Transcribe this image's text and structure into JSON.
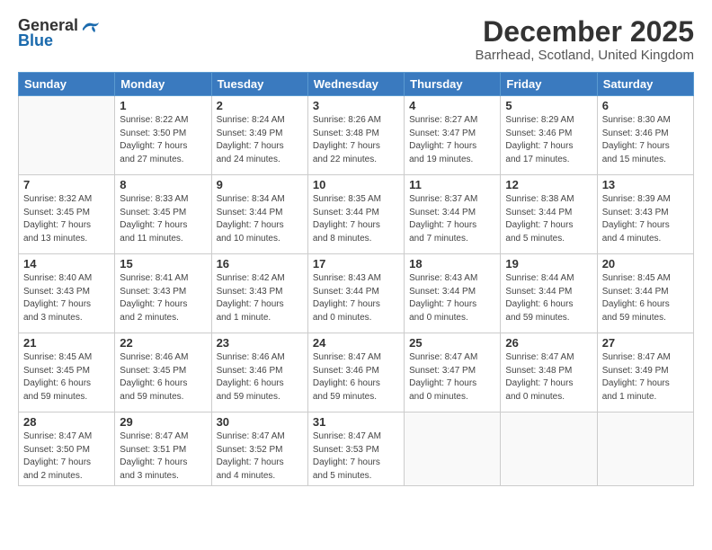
{
  "logo": {
    "general": "General",
    "blue": "Blue"
  },
  "title": "December 2025",
  "location": "Barrhead, Scotland, United Kingdom",
  "headers": [
    "Sunday",
    "Monday",
    "Tuesday",
    "Wednesday",
    "Thursday",
    "Friday",
    "Saturday"
  ],
  "weeks": [
    [
      {
        "day": "",
        "content": ""
      },
      {
        "day": "1",
        "content": "Sunrise: 8:22 AM\nSunset: 3:50 PM\nDaylight: 7 hours\nand 27 minutes."
      },
      {
        "day": "2",
        "content": "Sunrise: 8:24 AM\nSunset: 3:49 PM\nDaylight: 7 hours\nand 24 minutes."
      },
      {
        "day": "3",
        "content": "Sunrise: 8:26 AM\nSunset: 3:48 PM\nDaylight: 7 hours\nand 22 minutes."
      },
      {
        "day": "4",
        "content": "Sunrise: 8:27 AM\nSunset: 3:47 PM\nDaylight: 7 hours\nand 19 minutes."
      },
      {
        "day": "5",
        "content": "Sunrise: 8:29 AM\nSunset: 3:46 PM\nDaylight: 7 hours\nand 17 minutes."
      },
      {
        "day": "6",
        "content": "Sunrise: 8:30 AM\nSunset: 3:46 PM\nDaylight: 7 hours\nand 15 minutes."
      }
    ],
    [
      {
        "day": "7",
        "content": "Sunrise: 8:32 AM\nSunset: 3:45 PM\nDaylight: 7 hours\nand 13 minutes."
      },
      {
        "day": "8",
        "content": "Sunrise: 8:33 AM\nSunset: 3:45 PM\nDaylight: 7 hours\nand 11 minutes."
      },
      {
        "day": "9",
        "content": "Sunrise: 8:34 AM\nSunset: 3:44 PM\nDaylight: 7 hours\nand 10 minutes."
      },
      {
        "day": "10",
        "content": "Sunrise: 8:35 AM\nSunset: 3:44 PM\nDaylight: 7 hours\nand 8 minutes."
      },
      {
        "day": "11",
        "content": "Sunrise: 8:37 AM\nSunset: 3:44 PM\nDaylight: 7 hours\nand 7 minutes."
      },
      {
        "day": "12",
        "content": "Sunrise: 8:38 AM\nSunset: 3:44 PM\nDaylight: 7 hours\nand 5 minutes."
      },
      {
        "day": "13",
        "content": "Sunrise: 8:39 AM\nSunset: 3:43 PM\nDaylight: 7 hours\nand 4 minutes."
      }
    ],
    [
      {
        "day": "14",
        "content": "Sunrise: 8:40 AM\nSunset: 3:43 PM\nDaylight: 7 hours\nand 3 minutes."
      },
      {
        "day": "15",
        "content": "Sunrise: 8:41 AM\nSunset: 3:43 PM\nDaylight: 7 hours\nand 2 minutes."
      },
      {
        "day": "16",
        "content": "Sunrise: 8:42 AM\nSunset: 3:43 PM\nDaylight: 7 hours\nand 1 minute."
      },
      {
        "day": "17",
        "content": "Sunrise: 8:43 AM\nSunset: 3:44 PM\nDaylight: 7 hours\nand 0 minutes."
      },
      {
        "day": "18",
        "content": "Sunrise: 8:43 AM\nSunset: 3:44 PM\nDaylight: 7 hours\nand 0 minutes."
      },
      {
        "day": "19",
        "content": "Sunrise: 8:44 AM\nSunset: 3:44 PM\nDaylight: 6 hours\nand 59 minutes."
      },
      {
        "day": "20",
        "content": "Sunrise: 8:45 AM\nSunset: 3:44 PM\nDaylight: 6 hours\nand 59 minutes."
      }
    ],
    [
      {
        "day": "21",
        "content": "Sunrise: 8:45 AM\nSunset: 3:45 PM\nDaylight: 6 hours\nand 59 minutes."
      },
      {
        "day": "22",
        "content": "Sunrise: 8:46 AM\nSunset: 3:45 PM\nDaylight: 6 hours\nand 59 minutes."
      },
      {
        "day": "23",
        "content": "Sunrise: 8:46 AM\nSunset: 3:46 PM\nDaylight: 6 hours\nand 59 minutes."
      },
      {
        "day": "24",
        "content": "Sunrise: 8:47 AM\nSunset: 3:46 PM\nDaylight: 6 hours\nand 59 minutes."
      },
      {
        "day": "25",
        "content": "Sunrise: 8:47 AM\nSunset: 3:47 PM\nDaylight: 7 hours\nand 0 minutes."
      },
      {
        "day": "26",
        "content": "Sunrise: 8:47 AM\nSunset: 3:48 PM\nDaylight: 7 hours\nand 0 minutes."
      },
      {
        "day": "27",
        "content": "Sunrise: 8:47 AM\nSunset: 3:49 PM\nDaylight: 7 hours\nand 1 minute."
      }
    ],
    [
      {
        "day": "28",
        "content": "Sunrise: 8:47 AM\nSunset: 3:50 PM\nDaylight: 7 hours\nand 2 minutes."
      },
      {
        "day": "29",
        "content": "Sunrise: 8:47 AM\nSunset: 3:51 PM\nDaylight: 7 hours\nand 3 minutes."
      },
      {
        "day": "30",
        "content": "Sunrise: 8:47 AM\nSunset: 3:52 PM\nDaylight: 7 hours\nand 4 minutes."
      },
      {
        "day": "31",
        "content": "Sunrise: 8:47 AM\nSunset: 3:53 PM\nDaylight: 7 hours\nand 5 minutes."
      },
      {
        "day": "",
        "content": ""
      },
      {
        "day": "",
        "content": ""
      },
      {
        "day": "",
        "content": ""
      }
    ]
  ]
}
